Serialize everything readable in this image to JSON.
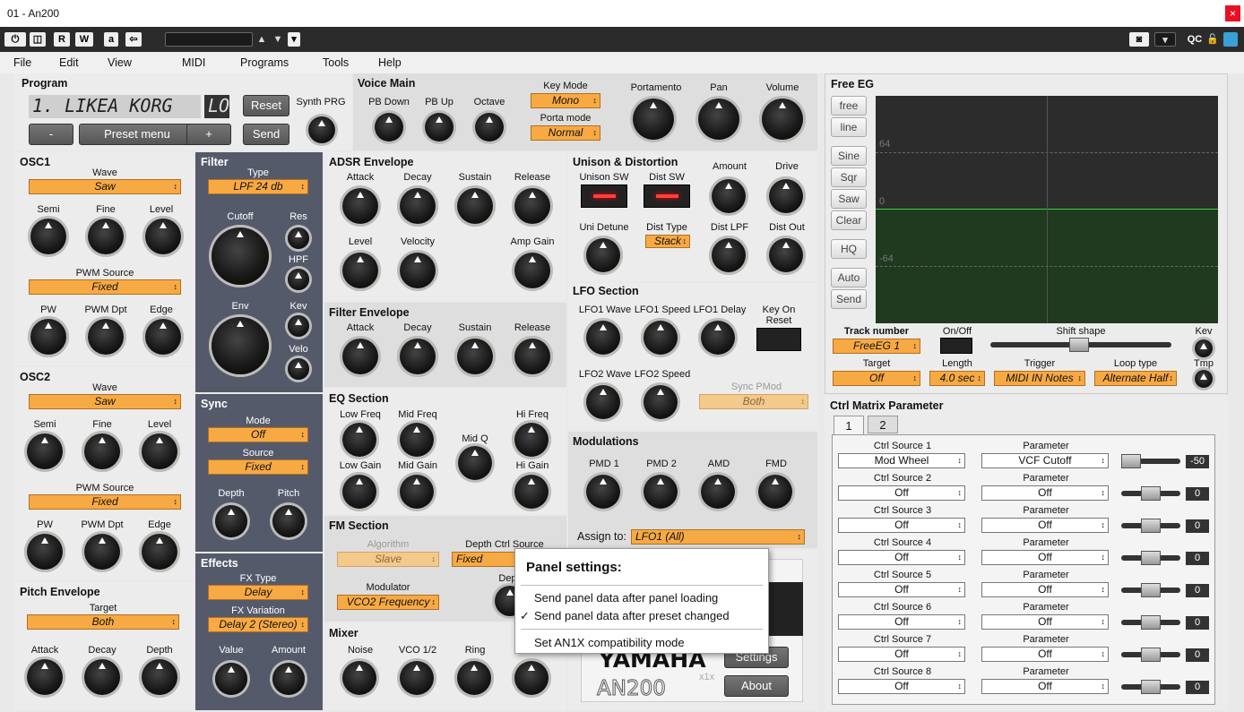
{
  "window": {
    "title": "01 - An200",
    "close": "×"
  },
  "toolbar": {
    "r": "R",
    "w": "W",
    "a": "a",
    "arrow": "⇦",
    "qc": "QC"
  },
  "menu": [
    "File",
    "Edit",
    "View",
    "MIDI",
    "Programs",
    "Tools",
    "Help"
  ],
  "program": {
    "title": "Program",
    "lcd": "1. LIKEA KORG",
    "lcd2": "LO",
    "reset": "Reset",
    "synth_prg": "Synth PRG",
    "minus": "-",
    "preset": "Preset menu",
    "plus": "+",
    "send": "Send"
  },
  "voice_main": {
    "title": "Voice Main",
    "pb_down": "PB Down",
    "pb_up": "PB Up",
    "octave": "Octave",
    "key_mode": "Key Mode",
    "key_mode_val": "Mono",
    "porta_mode": "Porta mode",
    "porta_mode_val": "Normal",
    "portamento": "Portamento",
    "pan": "Pan",
    "volume": "Volume"
  },
  "osc1": {
    "title": "OSC1",
    "wave": "Wave",
    "wave_val": "Saw",
    "semi": "Semi",
    "fine": "Fine",
    "level": "Level",
    "pwm_source": "PWM Source",
    "pwm_val": "Fixed",
    "pw": "PW",
    "pwm_dpt": "PWM Dpt",
    "edge": "Edge"
  },
  "osc2": {
    "title": "OSC2",
    "wave": "Wave",
    "wave_val": "Saw",
    "semi": "Semi",
    "fine": "Fine",
    "level": "Level",
    "pwm_source": "PWM Source",
    "pwm_val": "Fixed",
    "pw": "PW",
    "pwm_dpt": "PWM Dpt",
    "edge": "Edge"
  },
  "pitch_env": {
    "title": "Pitch Envelope",
    "target": "Target",
    "target_val": "Both",
    "attack": "Attack",
    "decay": "Decay",
    "depth": "Depth"
  },
  "filter": {
    "title": "Filter",
    "type": "Type",
    "type_val": "LPF 24 db",
    "cutoff": "Cutoff",
    "res": "Res",
    "hpf": "HPF",
    "env": "Env",
    "kev": "Kev",
    "velo": "Velo"
  },
  "sync": {
    "title": "Sync",
    "mode": "Mode",
    "mode_val": "Off",
    "source": "Source",
    "source_val": "Fixed",
    "depth": "Depth",
    "pitch": "Pitch"
  },
  "effects": {
    "title": "Effects",
    "fx_type": "FX Type",
    "fx_type_val": "Delay",
    "fx_var": "FX Variation",
    "fx_var_val": "Delay 2 (Stereo)",
    "value": "Value",
    "amount": "Amount"
  },
  "adsr": {
    "title": "ADSR Envelope",
    "attack": "Attack",
    "decay": "Decay",
    "sustain": "Sustain",
    "release": "Release",
    "level": "Level",
    "velocity": "Velocity",
    "amp_gain": "Amp Gain"
  },
  "fenv": {
    "title": "Filter Envelope",
    "attack": "Attack",
    "decay": "Decay",
    "sustain": "Sustain",
    "release": "Release"
  },
  "eq": {
    "title": "EQ Section",
    "low_freq": "Low Freq",
    "mid_freq": "Mid Freq",
    "mid_q": "Mid Q",
    "hi_freq": "Hi Freq",
    "low_gain": "Low Gain",
    "mid_gain": "Mid Gain",
    "hi_gain": "Hi Gain"
  },
  "fm": {
    "title": "FM Section",
    "algorithm": "Algorithm",
    "algorithm_val": "Slave",
    "depth_ctrl": "Depth Ctrl Source",
    "depth_ctrl_val": "Fixed",
    "modulator": "Modulator",
    "modulator_val": "VCO2 Frequency",
    "dept": "Dept"
  },
  "mixer": {
    "title": "Mixer",
    "noise": "Noise",
    "vco12": "VCO 1/2",
    "ring": "Ring"
  },
  "unison": {
    "title": "Unison & Distortion",
    "unison_sw": "Unison SW",
    "dist_sw": "Dist SW",
    "amount": "Amount",
    "drive": "Drive",
    "uni_detune": "Uni Detune",
    "dist_type": "Dist Type",
    "dist_type_val": "Stack",
    "dist_lpf": "Dist LPF",
    "dist_out": "Dist Out"
  },
  "lfo": {
    "title": "LFO Section",
    "lfo1_wave": "LFO1 Wave",
    "lfo1_speed": "LFO1 Speed",
    "lfo1_delay": "LFO1 Delay",
    "key_on_reset": "Key On Reset",
    "lfo2_wave": "LFO2 Wave",
    "lfo2_speed": "LFO2 Speed",
    "sync_pmod": "Sync PMod",
    "sync_pmod_val": "Both"
  },
  "mod": {
    "title": "Modulations",
    "pmd1": "PMD 1",
    "pmd2": "PMD 2",
    "amd": "AMD",
    "fmd": "FMD",
    "assign_to": "Assign to:",
    "assign_val": "LFO1 (All)"
  },
  "brand": {
    "yamaha": "YAMAHA",
    "an200": "AN200",
    "x1": "x1x",
    "settings": "Settings",
    "about": "About"
  },
  "free_eg": {
    "title": "Free EG",
    "buttons": [
      "free",
      "line",
      "Sine",
      "Sqr",
      "Saw",
      "Clear",
      "HQ",
      "Auto",
      "Send"
    ],
    "y64": "64",
    "y0": "0",
    "ym64": "-64",
    "track_number": "Track number",
    "track_val": "FreeEG 1",
    "onoff": "On/Off",
    "shift": "Shift shape",
    "kev": "Kev",
    "target": "Target",
    "target_val": "Off",
    "length": "Length",
    "length_val": "4.0 sec",
    "trigger": "Trigger",
    "trigger_val": "MIDI IN Notes",
    "loop": "Loop type",
    "loop_val": "Alternate Half",
    "tmp": "Tmp"
  },
  "ctrl": {
    "title": "Ctrl Matrix Parameter",
    "tab1": "1",
    "tab2": "2",
    "param": "Parameter",
    "rows": [
      {
        "src_label": "Ctrl Source 1",
        "src": "Mod Wheel",
        "param": "VCF Cutoff",
        "value": "-50",
        "level": 0.0
      },
      {
        "src_label": "Ctrl Source 2",
        "src": "Off",
        "param": "Off",
        "value": "0",
        "level": 0.5
      },
      {
        "src_label": "Ctrl Source 3",
        "src": "Off",
        "param": "Off",
        "value": "0",
        "level": 0.5
      },
      {
        "src_label": "Ctrl Source 4",
        "src": "Off",
        "param": "Off",
        "value": "0",
        "level": 0.5
      },
      {
        "src_label": "Ctrl Source 5",
        "src": "Off",
        "param": "Off",
        "value": "0",
        "level": 0.5
      },
      {
        "src_label": "Ctrl Source 6",
        "src": "Off",
        "param": "Off",
        "value": "0",
        "level": 0.5
      },
      {
        "src_label": "Ctrl Source 7",
        "src": "Off",
        "param": "Off",
        "value": "0",
        "level": 0.5
      },
      {
        "src_label": "Ctrl Source 8",
        "src": "Off",
        "param": "Off",
        "value": "0",
        "level": 0.5
      }
    ]
  },
  "popup": {
    "title": "Panel settings:",
    "item1": "Send panel data after panel loading",
    "item2": "Send panel data after preset changed",
    "check": "✓",
    "item3": "Set AN1X compatibility mode"
  },
  "colors": {
    "accent": "#f7a944",
    "panel_dark": "#555a6b",
    "eg_green": "#1e3a1e"
  }
}
